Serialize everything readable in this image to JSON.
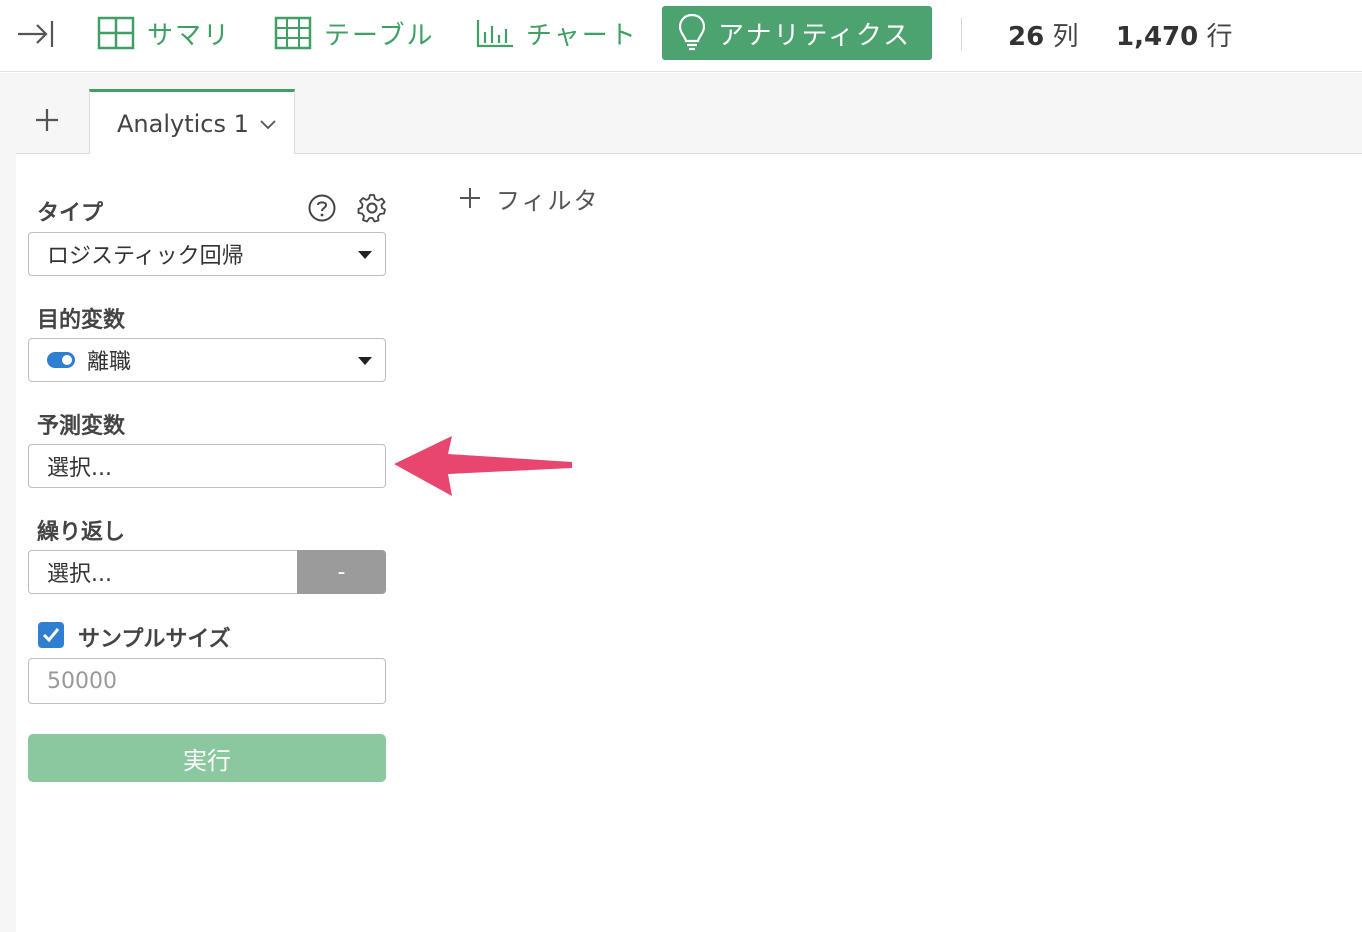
{
  "toolbar": {
    "collapse_icon": "collapse-right-icon",
    "nav": [
      {
        "label": "サマリ",
        "icon": "summary-grid-icon"
      },
      {
        "label": "テーブル",
        "icon": "table-icon"
      },
      {
        "label": "チャート",
        "icon": "bar-chart-icon"
      },
      {
        "label": "アナリティクス",
        "icon": "lightbulb-icon",
        "active": true
      }
    ],
    "columns_count": "26",
    "columns_unit": "列",
    "rows_count": "1,470",
    "rows_unit": "行"
  },
  "tabs": {
    "add_icon": "plus-icon",
    "items": [
      {
        "label": "Analytics 1",
        "icon": "chevron-down-icon"
      }
    ]
  },
  "form": {
    "type_label": "タイプ",
    "type_value": "ロジスティック回帰",
    "target_label": "目的変数",
    "target_value": "離職",
    "predictor_label": "予測変数",
    "predictor_placeholder": "選択...",
    "repeat_label": "繰り返し",
    "repeat_placeholder": "選択...",
    "repeat_button": "-",
    "sample_label": "サンプルサイズ",
    "sample_checked": true,
    "sample_value": "50000",
    "run_label": "実行"
  },
  "filter": {
    "label": "フィルタ",
    "icon": "plus-icon"
  },
  "colors": {
    "accent_green": "#3f9f65",
    "active_tab_bg": "#4ca36f",
    "run_button": "#8bc8a0",
    "annotation_arrow": "#e8456f",
    "toggle_blue": "#2f7fd1"
  }
}
